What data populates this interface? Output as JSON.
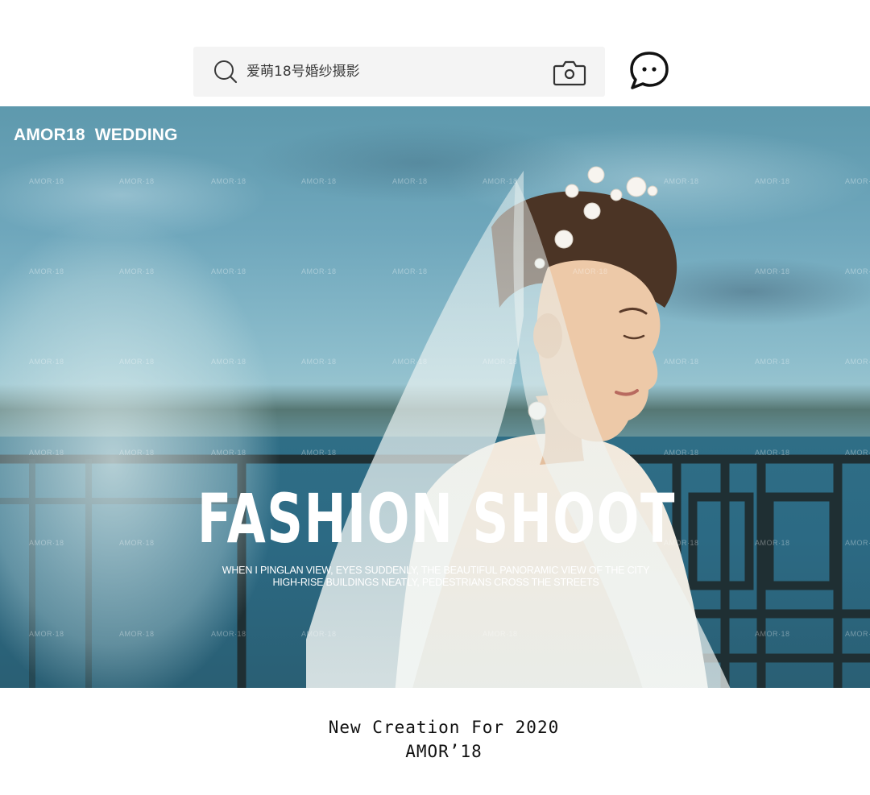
{
  "search": {
    "placeholder": "爱萌18号婚纱摄影",
    "search_icon": "search-icon",
    "camera_icon": "camera-icon"
  },
  "header": {
    "chat_icon": "chat-bubble-icon"
  },
  "hero": {
    "brand": "AMOR18  WEDDING",
    "title": "FASHION SHOOT",
    "subtitle_line1": "WHEN I PINGLAN VIEW, EYES SUDDENLY, THE BEAUTIFUL PANORAMIC VIEW OF THE CITY",
    "subtitle_line2": "HIGH-RISE BUILDINGS NEATLY, PEDESTRIANS CROSS THE STREETS",
    "watermark": "AMOR·18"
  },
  "caption": {
    "line1": "New Creation For 2020",
    "line2": "AMOR’18"
  },
  "colors": {
    "search_bg": "#f4f4f4",
    "icon_stroke": "#222222",
    "hero_text": "#ffffff"
  }
}
